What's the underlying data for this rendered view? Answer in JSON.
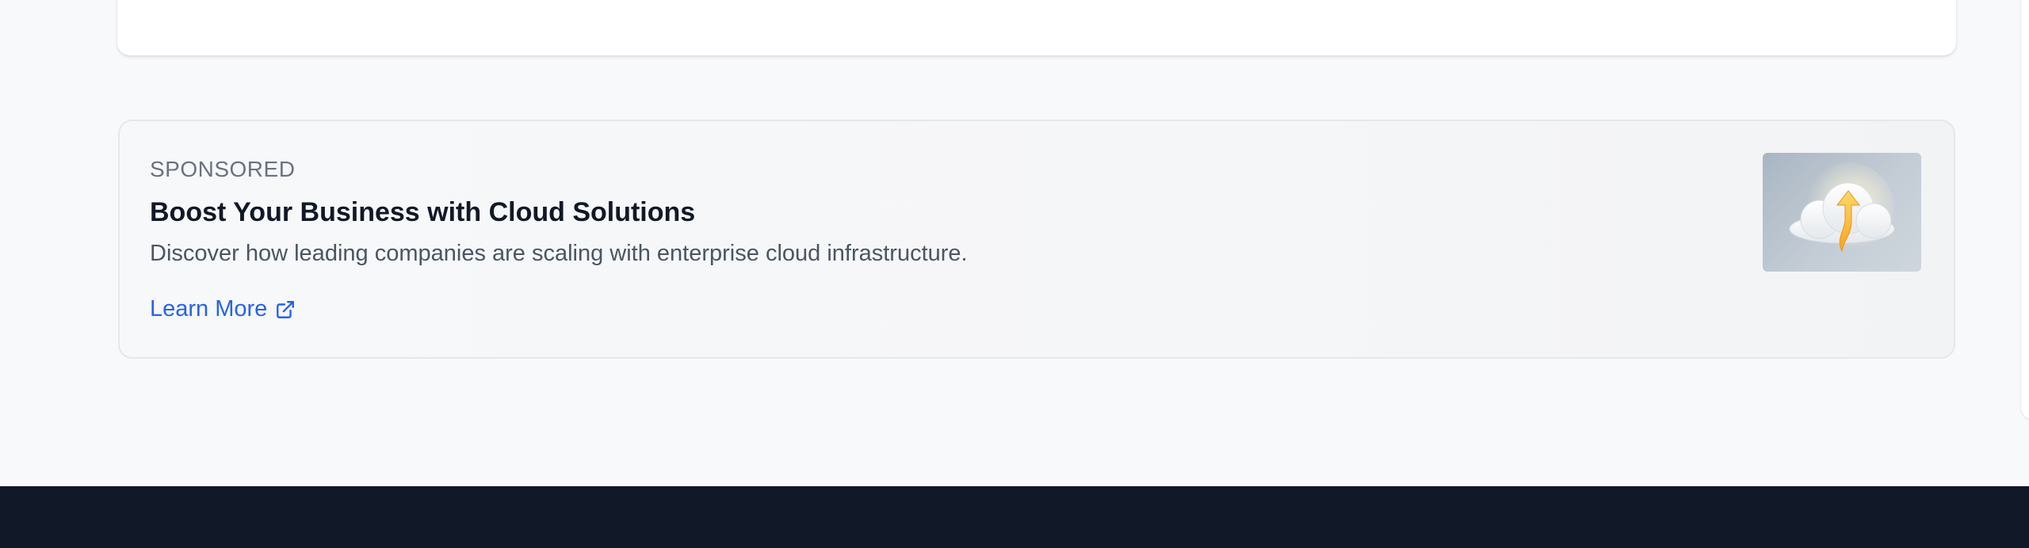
{
  "sponsored_ad": {
    "label": "SPONSORED",
    "headline": "Boost Your Business with Cloud Solutions",
    "description": "Discover how leading companies are scaling with enterprise cloud infrastructure.",
    "cta_label": "Learn More",
    "cta_icon": "external-link-icon",
    "thumbnail_icon": "cloud-upload-icon"
  },
  "colors": {
    "page_background": "#f8f9fb",
    "link": "#2563eb",
    "headline": "#111827",
    "footer": "#111827"
  }
}
